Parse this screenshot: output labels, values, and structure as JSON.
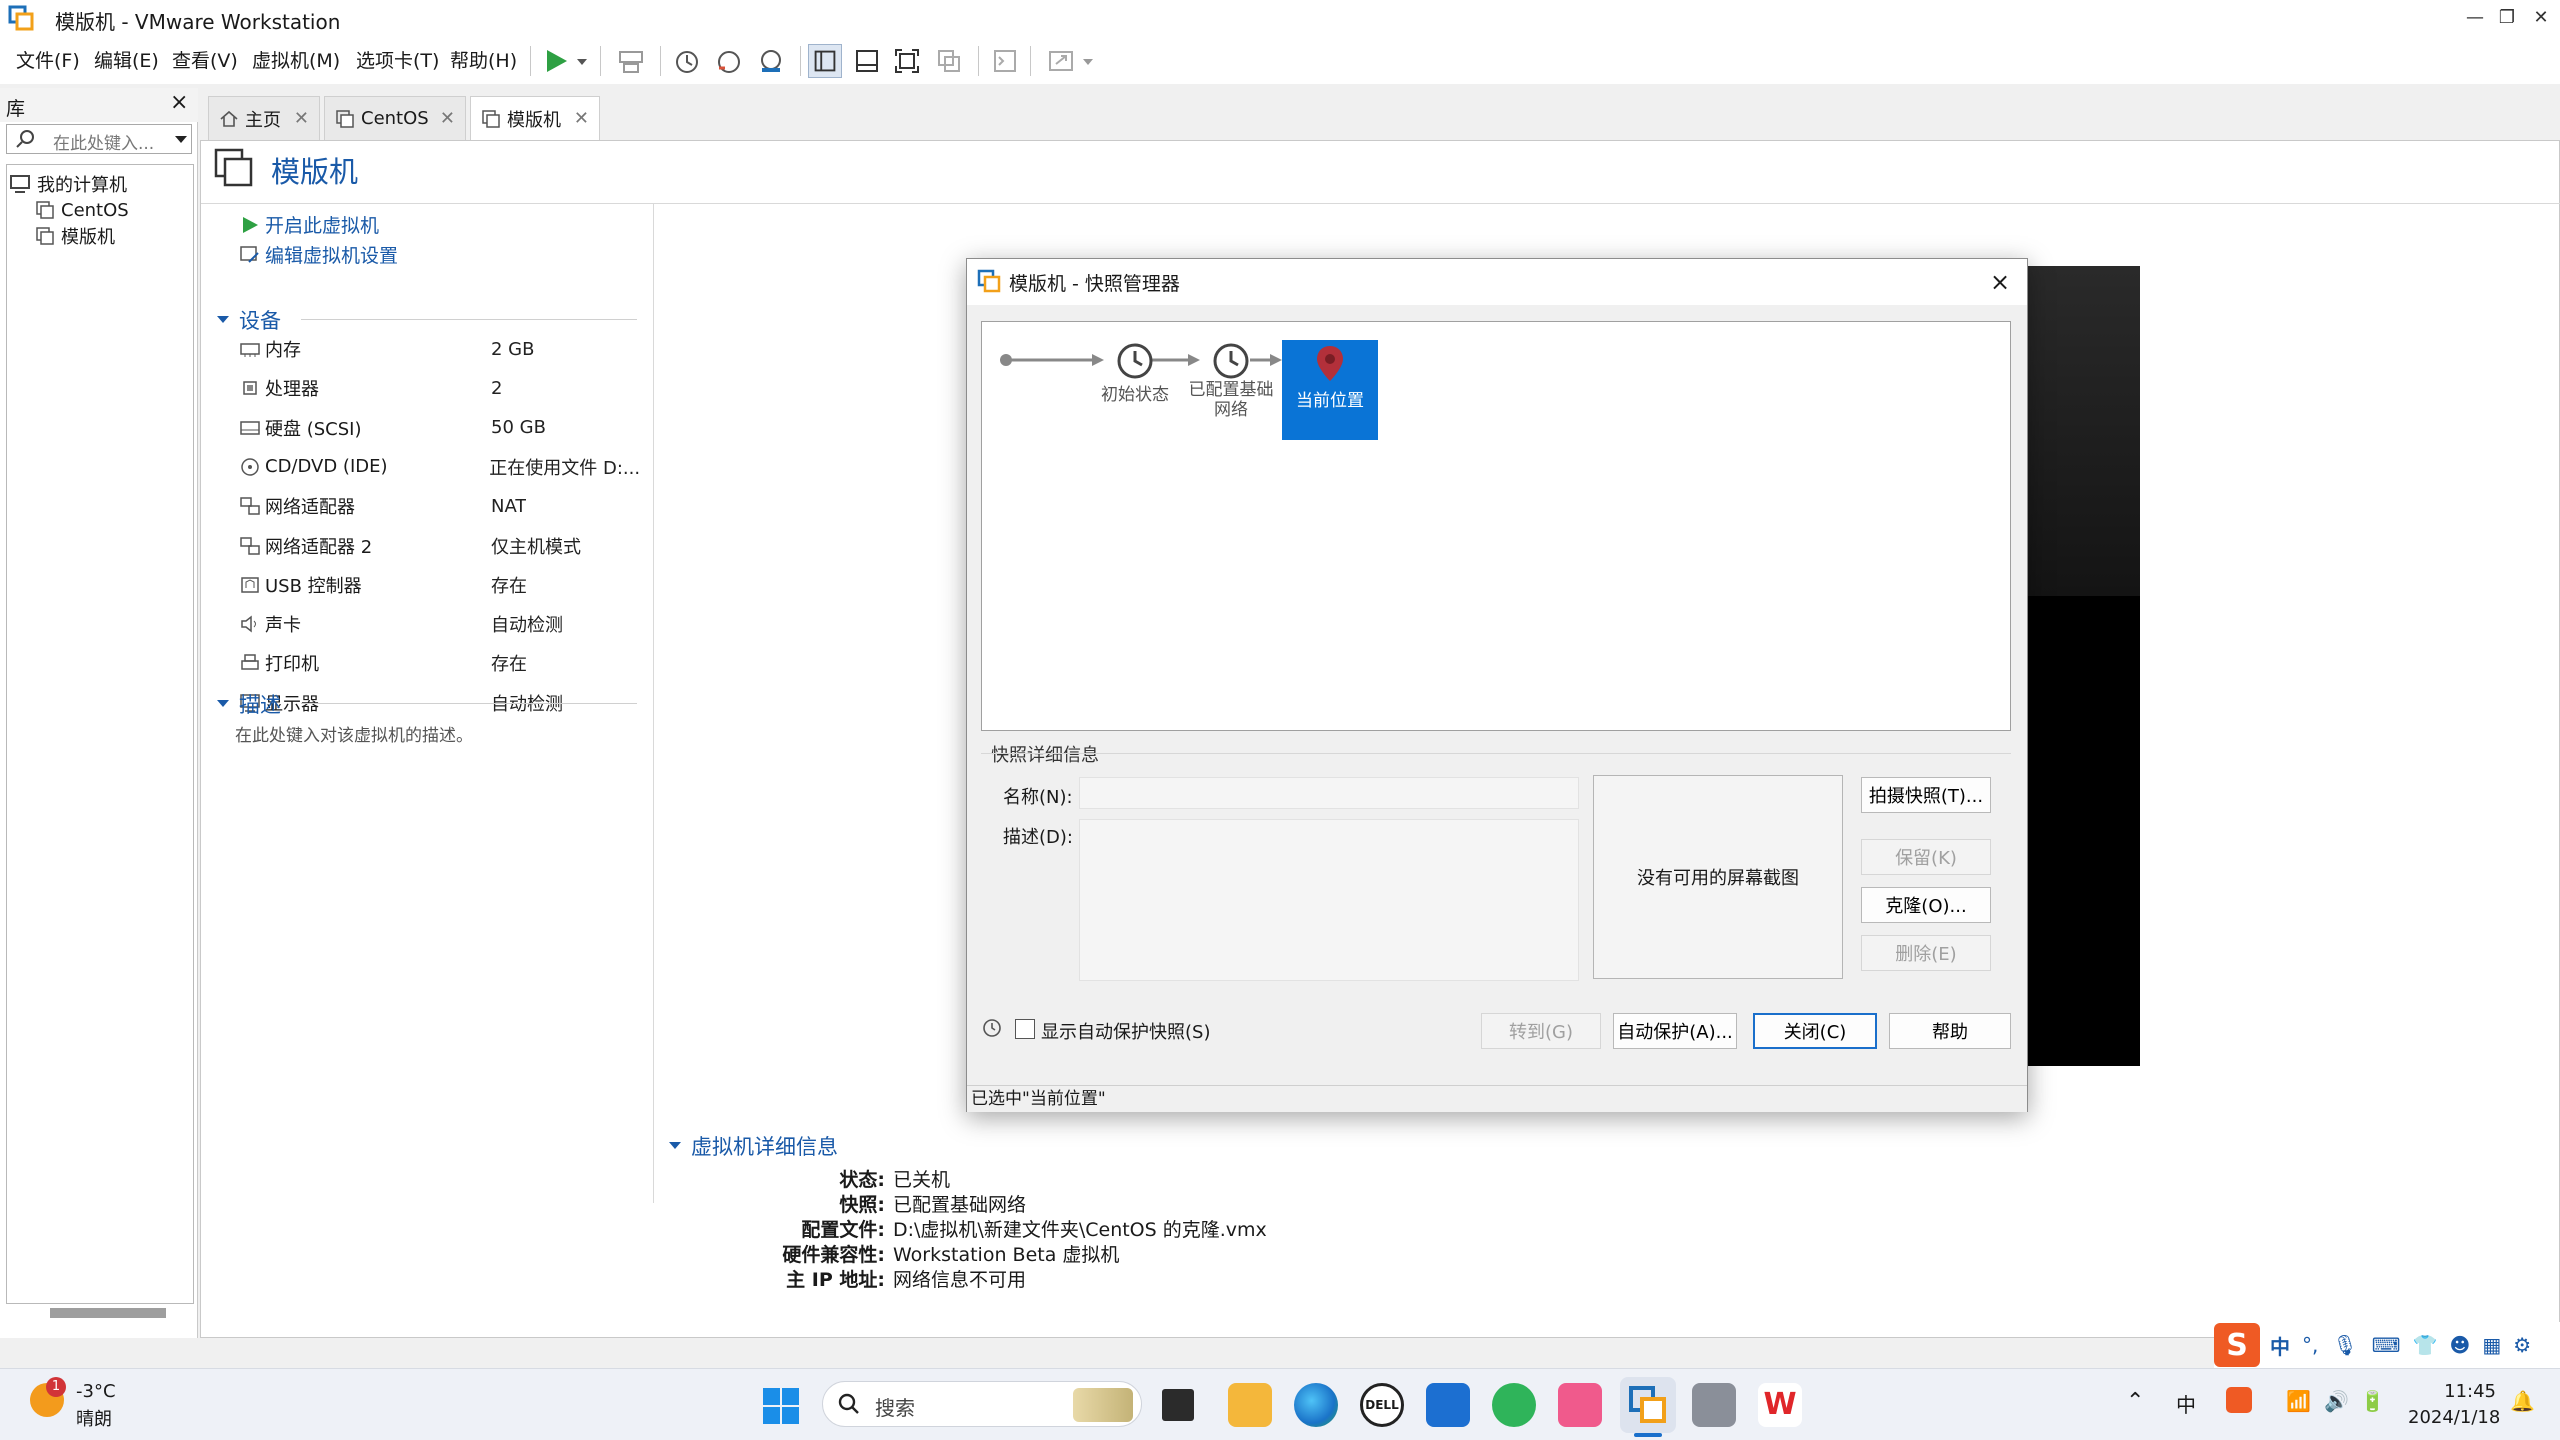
{
  "window": {
    "title": "模版机 - VMware Workstation"
  },
  "menu": {
    "items": [
      "文件(F)",
      "编辑(E)",
      "查看(V)",
      "虚拟机(M)",
      "选项卡(T)",
      "帮助(H)"
    ]
  },
  "library": {
    "title": "库",
    "close": "×",
    "search_placeholder": "在此处键入...",
    "tree": {
      "root": "我的计算机",
      "children": [
        "CentOS",
        "模版机"
      ]
    }
  },
  "tabs": [
    {
      "label": "主页"
    },
    {
      "label": "CentOS"
    },
    {
      "label": "模版机"
    }
  ],
  "vm": {
    "name": "模版机",
    "actions": {
      "start": "开启此虚拟机",
      "edit": "编辑虚拟机设置"
    },
    "devices_title": "设备",
    "devices": [
      {
        "name": "内存",
        "value": "2 GB",
        "icon": "memory-icon"
      },
      {
        "name": "处理器",
        "value": "2",
        "icon": "cpu-icon"
      },
      {
        "name": "硬盘 (SCSI)",
        "value": "50 GB",
        "icon": "harddisk-icon"
      },
      {
        "name": "CD/DVD (IDE)",
        "value": "正在使用文件 D:...",
        "icon": "cdrom-icon"
      },
      {
        "name": "网络适配器",
        "value": "NAT",
        "icon": "network-icon"
      },
      {
        "name": "网络适配器 2",
        "value": "仅主机模式",
        "icon": "network-icon"
      },
      {
        "name": "USB 控制器",
        "value": "存在",
        "icon": "usb-icon"
      },
      {
        "name": "声卡",
        "value": "自动检测",
        "icon": "sound-icon"
      },
      {
        "name": "打印机",
        "value": "存在",
        "icon": "printer-icon"
      },
      {
        "name": "显示器",
        "value": "自动检测",
        "icon": "display-icon"
      }
    ],
    "description_title": "描述",
    "description_placeholder": "在此处键入对该虚拟机的描述。",
    "details": {
      "title": "虚拟机详细信息",
      "rows": [
        {
          "key": "状态:",
          "value": "已关机"
        },
        {
          "key": "快照:",
          "value": "已配置基础网络"
        },
        {
          "key": "配置文件:",
          "value": "D:\\虚拟机\\新建文件夹\\CentOS 的克隆.vmx"
        },
        {
          "key": "硬件兼容性:",
          "value": "Workstation Beta 虚拟机"
        },
        {
          "key": "主 IP 地址:",
          "value": "网络信息不可用"
        }
      ]
    }
  },
  "dialog": {
    "title": "模版机 - 快照管理器",
    "close": "×",
    "snapshots": [
      {
        "label": "初始状态"
      },
      {
        "label_line1": "已配置基础",
        "label_line2": "网络"
      },
      {
        "label": "当前位置"
      }
    ],
    "details_title": "快照详细信息",
    "name_label": "名称(N):",
    "desc_label": "描述(D):",
    "no_screenshot": "没有可用的屏幕截图",
    "buttons": {
      "take": "拍摄快照(T)...",
      "keep": "保留(K)",
      "clone": "克隆(O)...",
      "delete": "删除(E)",
      "goto": "转到(G)",
      "autoprotect": "自动保护(A)...",
      "close": "关闭(C)",
      "help": "帮助"
    },
    "show_autoprotect": "显示自动保护快照(S)",
    "status": "已选中\"当前位置\""
  },
  "taskbar": {
    "weather_temp": "-3°C",
    "weather_text": "晴朗",
    "weather_badge": "1",
    "search": "搜索",
    "time": "11:45",
    "date": "2024/1/18",
    "ime_lang": "中"
  },
  "colors": {
    "accent": "#1a5aa8",
    "selection": "#0a74d6",
    "play": "#2ea043"
  }
}
